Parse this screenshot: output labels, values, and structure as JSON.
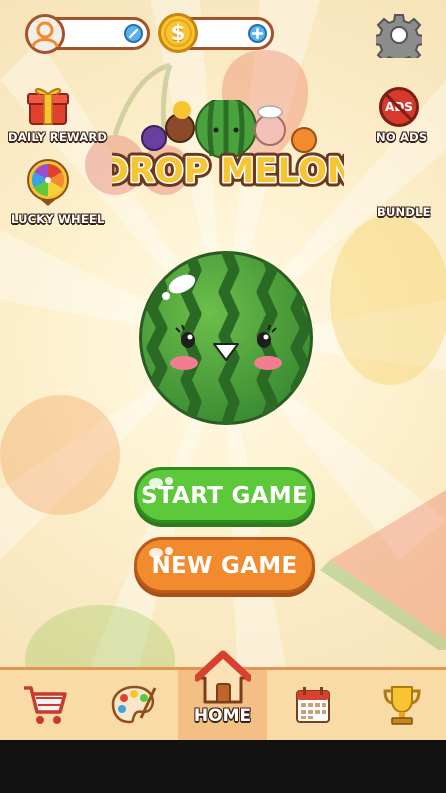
{
  "title": "DROP MELON",
  "profile": {
    "value": ""
  },
  "coins": {
    "value": ""
  },
  "side_left": [
    {
      "label": "DAILY REWARD",
      "icon": "gift-icon"
    },
    {
      "label": "LUCKY WHEEL",
      "icon": "wheel-icon"
    }
  ],
  "side_right": [
    {
      "label": "NO ADS",
      "icon": "no-ads-icon",
      "badge": "ADS"
    },
    {
      "label": "BUNDLE",
      "icon": "bundle-icon"
    }
  ],
  "buttons": {
    "start": "START GAME",
    "new": "NEW GAME"
  },
  "nav": [
    {
      "label": "",
      "icon": "cart-icon"
    },
    {
      "label": "",
      "icon": "palette-icon"
    },
    {
      "label": "HOME",
      "icon": "home-icon",
      "active": true
    },
    {
      "label": "",
      "icon": "calendar-icon"
    },
    {
      "label": "",
      "icon": "trophy-icon"
    }
  ],
  "colors": {
    "start_button": "#5dc83a",
    "new_button": "#f28a2e",
    "nav_bg": "#f9dba7",
    "nav_active": "#f3bf84",
    "watermelon_green": "#3f9b37"
  }
}
